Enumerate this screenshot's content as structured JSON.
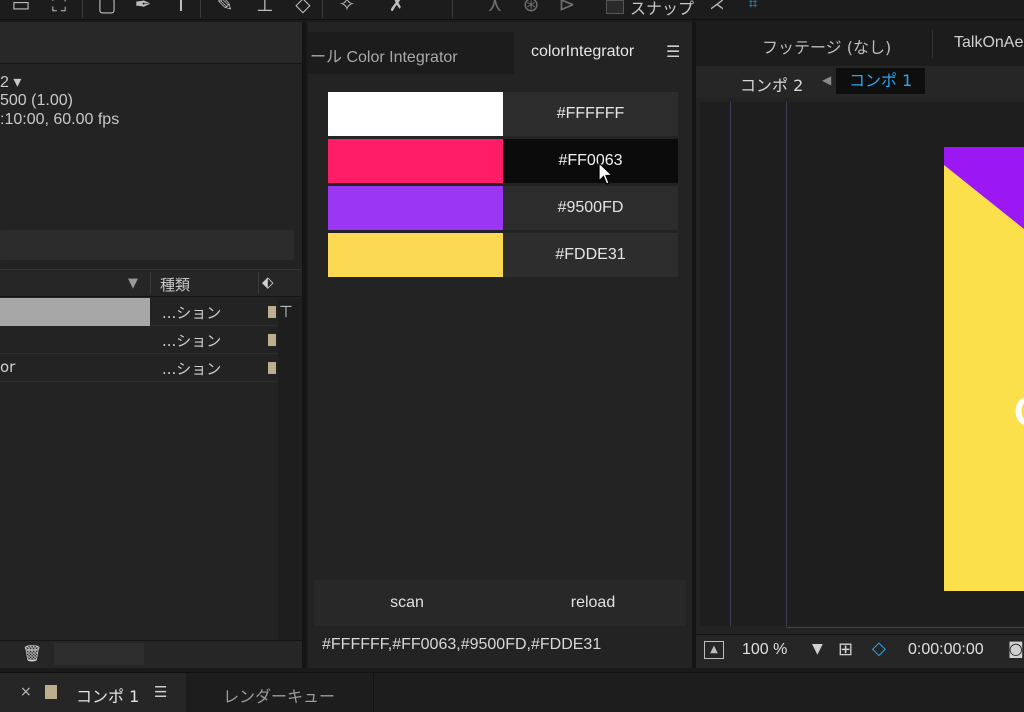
{
  "toolbar": {
    "snap_label": "スナップ",
    "icons": [
      "hand-tool-icon",
      "zoom-tool-icon",
      "shape-tool-icon",
      "pen-tool-icon",
      "type-tool-icon",
      "brush-tool-icon",
      "stamp-tool-icon",
      "eraser-tool-icon",
      "roto-tool-icon",
      "puppet-tool-icon"
    ]
  },
  "project_panel": {
    "info_line_1": "2 ▾",
    "info_line_2": "500 (1.00)",
    "info_line_3": ":10:00, 60.00 fps",
    "column_type_header": "種類",
    "rows": [
      {
        "name": "",
        "type": "...ション"
      },
      {
        "name": "",
        "type": "...ション"
      },
      {
        "name": "or",
        "type": "...ション"
      }
    ]
  },
  "plugin_panel": {
    "tab_inactive": "ール Color Integrator",
    "tab_active": "colorIntegrator",
    "swatches": [
      {
        "color": "#FFFFFF",
        "hex": "#FFFFFF"
      },
      {
        "color": "#FF1D67",
        "hex": "#FF0063"
      },
      {
        "color": "#9B36F2",
        "hex": "#9500FD"
      },
      {
        "color": "#FBD952",
        "hex": "#FDDE31"
      }
    ],
    "scan_label": "scan",
    "reload_label": "reload",
    "output": "#FFFFFF,#FF0063,#9500FD,#FDDE31"
  },
  "viewer_panel": {
    "tab_footage": "フッテージ (なし)",
    "tab_talk": "TalkOnAe",
    "nav_comp2": "コンポ 2",
    "nav_comp1": "コンポ 1",
    "canvas_char": "C",
    "zoom": "100 %",
    "timecode": "0:00:00:00",
    "colors": {
      "purple": "#9B17F4",
      "yellow": "#FCE04B",
      "accent": "#29A7F0"
    }
  },
  "timeline_tabs": {
    "comp1_label": "コンポ 1",
    "render_queue_label": "レンダーキュー"
  }
}
